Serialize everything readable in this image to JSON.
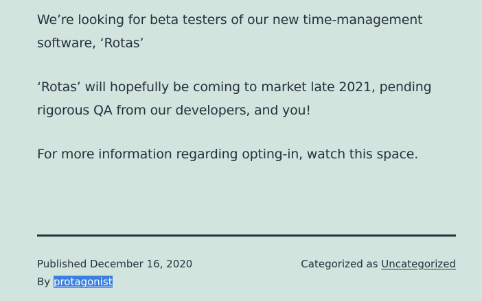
{
  "post": {
    "paragraphs": [
      "We’re looking for beta testers of our new time-management software, ‘Rotas’",
      "‘Rotas’ will hopefully be coming to market late 2021, pending rigorous QA from our developers, and you!",
      "For more information regarding opting-in, watch this space."
    ]
  },
  "footer": {
    "published_label": "Published",
    "published_date": "December 16, 2020",
    "by_label": "By",
    "author": "protagonist",
    "categorized_label": "Categorized as",
    "category": "Uncategorized"
  },
  "colors": {
    "background": "#d1e4dd",
    "text": "#28303d",
    "selection": "#3b7fe0"
  }
}
